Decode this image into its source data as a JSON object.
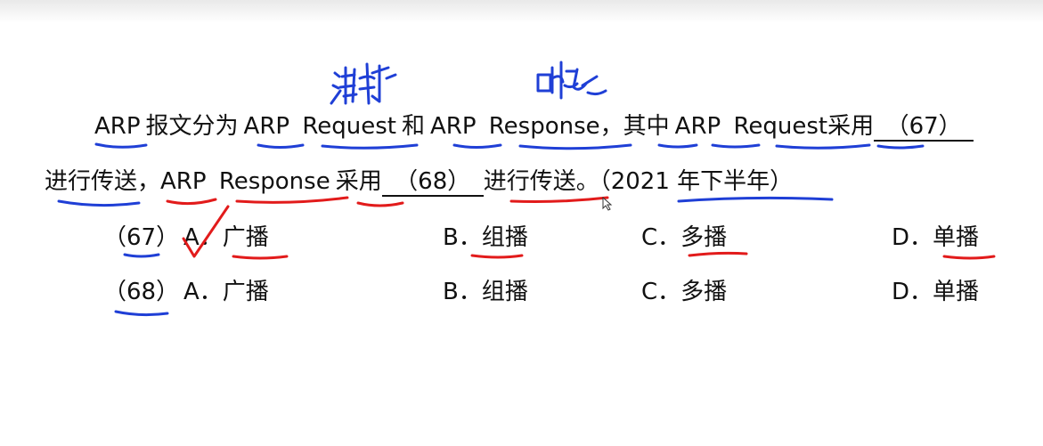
{
  "question": {
    "line1": {
      "t1": "ARP",
      "t2": "报文分为",
      "t3": "ARP",
      "t4": "Request",
      "t5": "和",
      "t6": "ARP",
      "t7": "Response，",
      "t8": "其中",
      "t9": "ARP",
      "t10": "Request",
      "t11": "采用",
      "blank67": "（67）"
    },
    "line2": {
      "t1": "进行传送，",
      "t2": "ARP",
      "t3": "Response",
      "t4": "采用",
      "blank68": "（68）",
      "t5": "进行传送。",
      "source": "（2021 年下半年）"
    }
  },
  "options": [
    {
      "number": "（67）",
      "a": "A．广播",
      "b": "B．组播",
      "c": "C．多播",
      "d": "D．单播"
    },
    {
      "number": "（68）",
      "a": "A．广播",
      "b": "B．组播",
      "c": "C．多播",
      "d": "D．单播"
    }
  ],
  "colors": {
    "blue_ink": "#1f3fd6",
    "red_ink": "#e21b1b",
    "text": "#111111"
  },
  "annotations": {
    "check_mark": "red check mark on option A of question 67",
    "handwriting_1": "handwritten note above first ARP Request",
    "handwriting_2": "handwritten note above ARP Response"
  }
}
